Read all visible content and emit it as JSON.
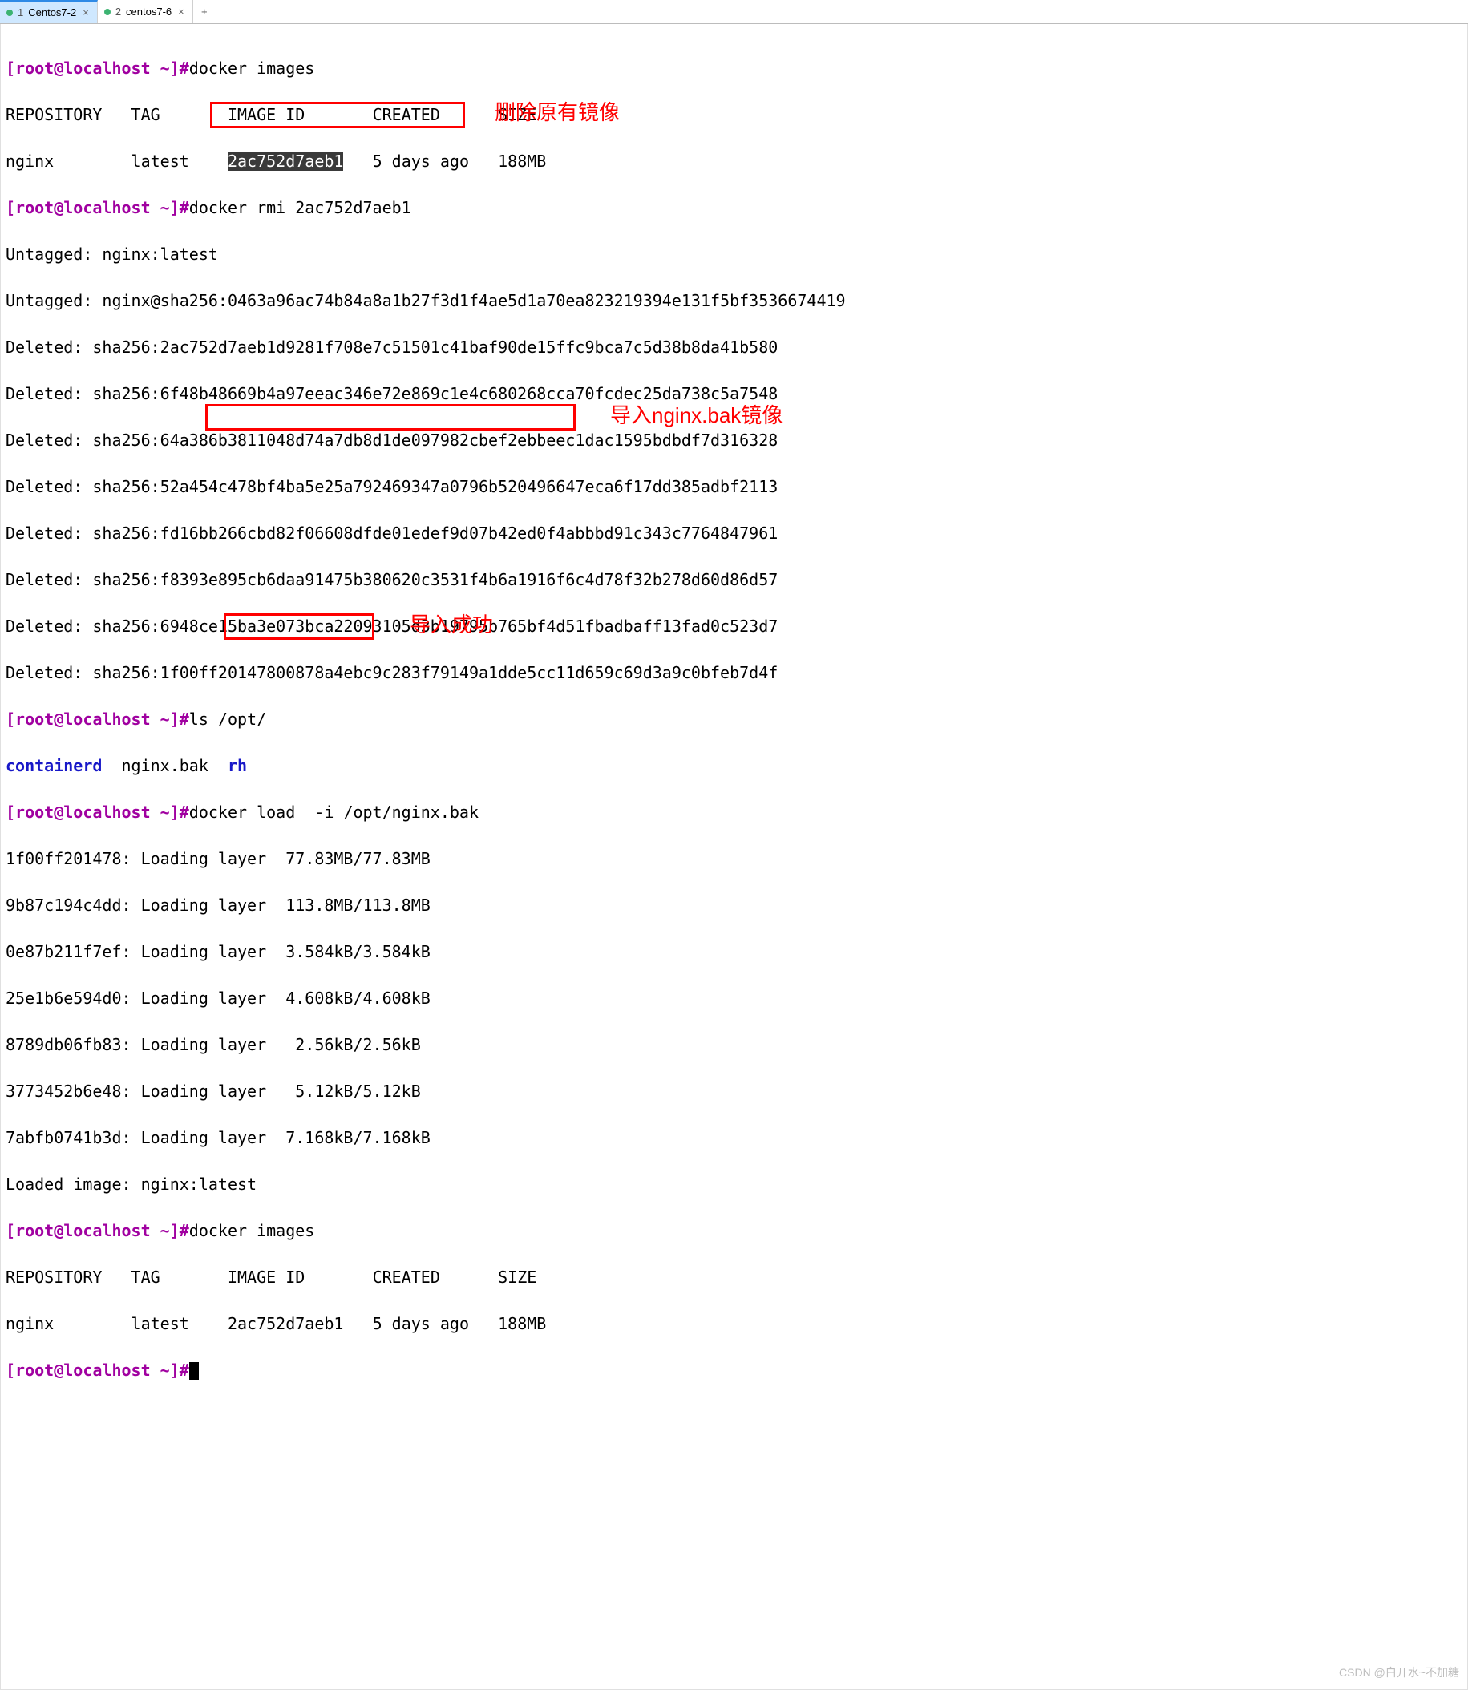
{
  "tabs": [
    {
      "num": "1",
      "title": "Centos7-2",
      "active": true
    },
    {
      "num": "2",
      "title": "centos7-6",
      "active": false
    }
  ],
  "prompt": "[root@localhost ~]#",
  "cmds": {
    "images1": "docker images",
    "rmi": "docker rmi 2ac752d7aeb1",
    "lsopt": "ls /opt/",
    "load": "docker load  -i /opt/nginx.bak",
    "images2": "docker images"
  },
  "images_header": {
    "c1": "REPOSITORY",
    "c2": "TAG",
    "c3": "IMAGE ID",
    "c4": "CREATED",
    "c5": "SIZE"
  },
  "images_row": {
    "c1": "nginx",
    "c2": "latest",
    "c3": "2ac752d7aeb1",
    "c4": "5 days ago",
    "c5": "188MB"
  },
  "rmi_out": [
    "Untagged: nginx:latest",
    "Untagged: nginx@sha256:0463a96ac74b84a8a1b27f3d1f4ae5d1a70ea823219394e131f5bf3536674419",
    "Deleted: sha256:2ac752d7aeb1d9281f708e7c51501c41baf90de15ffc9bca7c5d38b8da41b580",
    "Deleted: sha256:6f48b48669b4a97eeac346e72e869c1e4c680268cca70fcdec25da738c5a7548",
    "Deleted: sha256:64a386b3811048d74a7db8d1de097982cbef2ebbeec1dac1595bdbdf7d316328",
    "Deleted: sha256:52a454c478bf4ba5e25a792469347a0796b520496647eca6f17dd385adbf2113",
    "Deleted: sha256:fd16bb266cbd82f06608dfde01edef9d07b42ed0f4abbbd91c343c7764847961",
    "Deleted: sha256:f8393e895cb6daa91475b380620c3531f4b6a1916f6c4d78f32b278d60d86d57",
    "Deleted: sha256:6948ce15ba3e073bca22093105d3b19795b765bf4d51fbadbaff13fad0c523d7",
    "Deleted: sha256:1f00ff20147800878a4ebc9c283f79149a1dde5cc11d659c69d3a9c0bfeb7d4f"
  ],
  "ls_out": {
    "c1": "containerd",
    "c2": "nginx.bak",
    "c3": "rh"
  },
  "load_out": [
    "1f00ff201478: Loading layer  77.83MB/77.83MB",
    "9b87c194c4dd: Loading layer  113.8MB/113.8MB",
    "0e87b211f7ef: Loading layer  3.584kB/3.584kB",
    "25e1b6e594d0: Loading layer  4.608kB/4.608kB",
    "8789db06fb83: Loading layer   2.56kB/2.56kB",
    "3773452b6e48: Loading layer   5.12kB/5.12kB",
    "7abfb0741b3d: Loading layer  7.168kB/7.168kB",
    "Loaded image: nginx:latest"
  ],
  "annotations": {
    "a1": "删除原有镜像",
    "a2": "导入nginx.bak镜像",
    "a3": "导入成功"
  },
  "watermark": "CSDN @白开水~不加糖"
}
